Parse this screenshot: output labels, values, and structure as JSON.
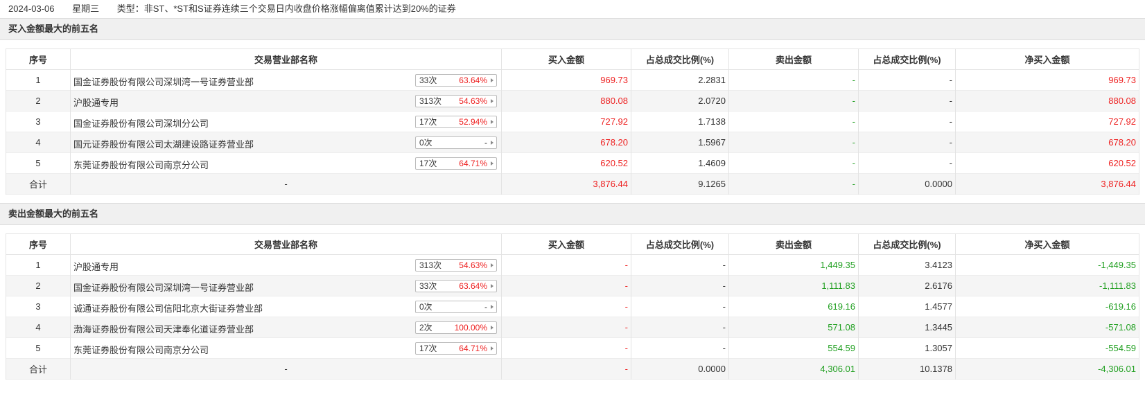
{
  "header": {
    "date": "2024-03-06",
    "weekday": "星期三",
    "type_text": "类型：非ST、*ST和S证券连续三个交易日内收盘价格涨幅偏离值累计达到20%的证券"
  },
  "columns": [
    "序号",
    "交易营业部名称",
    "买入金额",
    "占总成交比例(%)",
    "卖出金额",
    "占总成交比例(%)",
    "净买入金额"
  ],
  "buy_section": {
    "title": "买入金额最大的前五名",
    "rows": [
      {
        "idx": "1",
        "name": "国金证券股份有限公司深圳湾一号证券营业部",
        "count": "33次",
        "rate": "63.64%",
        "buy": "969.73",
        "buy_pct": "2.2831",
        "sell": "-",
        "sell_pct": "-",
        "net": "969.73"
      },
      {
        "idx": "2",
        "name": "沪股通专用",
        "count": "313次",
        "rate": "54.63%",
        "buy": "880.08",
        "buy_pct": "2.0720",
        "sell": "-",
        "sell_pct": "-",
        "net": "880.08"
      },
      {
        "idx": "3",
        "name": "国金证券股份有限公司深圳分公司",
        "count": "17次",
        "rate": "52.94%",
        "buy": "727.92",
        "buy_pct": "1.7138",
        "sell": "-",
        "sell_pct": "-",
        "net": "727.92"
      },
      {
        "idx": "4",
        "name": "国元证券股份有限公司太湖建设路证券营业部",
        "count": "0次",
        "rate": "-",
        "buy": "678.20",
        "buy_pct": "1.5967",
        "sell": "-",
        "sell_pct": "-",
        "net": "678.20"
      },
      {
        "idx": "5",
        "name": "东莞证券股份有限公司南京分公司",
        "count": "17次",
        "rate": "64.71%",
        "buy": "620.52",
        "buy_pct": "1.4609",
        "sell": "-",
        "sell_pct": "-",
        "net": "620.52"
      }
    ],
    "total": {
      "label": "合计",
      "name": "-",
      "buy": "3,876.44",
      "buy_pct": "9.1265",
      "sell": "-",
      "sell_pct": "0.0000",
      "net": "3,876.44"
    }
  },
  "sell_section": {
    "title": "卖出金额最大的前五名",
    "rows": [
      {
        "idx": "1",
        "name": "沪股通专用",
        "count": "313次",
        "rate": "54.63%",
        "buy": "-",
        "buy_pct": "-",
        "sell": "1,449.35",
        "sell_pct": "3.4123",
        "net": "-1,449.35"
      },
      {
        "idx": "2",
        "name": "国金证券股份有限公司深圳湾一号证券营业部",
        "count": "33次",
        "rate": "63.64%",
        "buy": "-",
        "buy_pct": "-",
        "sell": "1,111.83",
        "sell_pct": "2.6176",
        "net": "-1,111.83"
      },
      {
        "idx": "3",
        "name": "诚通证券股份有限公司信阳北京大街证券营业部",
        "count": "0次",
        "rate": "-",
        "buy": "-",
        "buy_pct": "-",
        "sell": "619.16",
        "sell_pct": "1.4577",
        "net": "-619.16"
      },
      {
        "idx": "4",
        "name": "渤海证券股份有限公司天津奉化道证券营业部",
        "count": "2次",
        "rate": "100.00%",
        "buy": "-",
        "buy_pct": "-",
        "sell": "571.08",
        "sell_pct": "1.3445",
        "net": "-571.08"
      },
      {
        "idx": "5",
        "name": "东莞证券股份有限公司南京分公司",
        "count": "17次",
        "rate": "64.71%",
        "buy": "-",
        "buy_pct": "-",
        "sell": "554.59",
        "sell_pct": "1.3057",
        "net": "-554.59"
      }
    ],
    "total": {
      "label": "合计",
      "name": "-",
      "buy": "-",
      "buy_pct": "0.0000",
      "sell": "4,306.01",
      "sell_pct": "10.1378",
      "net": "-4,306.01"
    }
  },
  "colors": {
    "up": "#ee2222",
    "down": "#22a022",
    "header_bg": "#f0f0f0"
  }
}
